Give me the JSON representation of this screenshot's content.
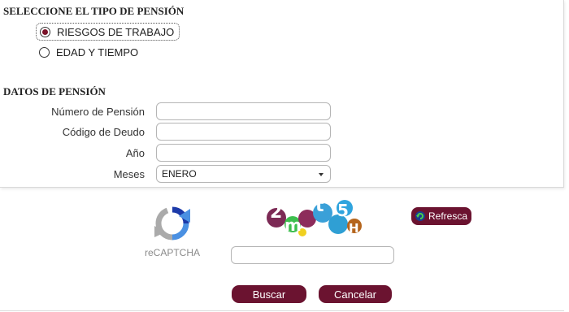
{
  "pension_type": {
    "title": "SELECCIONE EL TIPO DE PENSIÓN",
    "options": [
      {
        "label": "RIESGOS DE TRABAJO",
        "selected": true
      },
      {
        "label": "EDAD Y TIEMPO",
        "selected": false
      }
    ]
  },
  "pension_data": {
    "title": "DATOS DE PENSIÓN",
    "fields": {
      "numero_pension": {
        "label": "Número de Pensión",
        "value": ""
      },
      "codigo_deudo": {
        "label": "Código de Deudo",
        "value": ""
      },
      "anio": {
        "label": "Año",
        "value": ""
      },
      "meses": {
        "label": "Meses",
        "value": "ENERO"
      }
    }
  },
  "captcha": {
    "recaptcha_label": "reCAPTCHA",
    "image_text": "2mt5H",
    "refresh_label": "Refresca",
    "input_value": ""
  },
  "actions": {
    "search_label": "Buscar",
    "cancel_label": "Cancelar"
  },
  "colors": {
    "accent": "#6b1330",
    "radio_dot": "#7a1228"
  }
}
